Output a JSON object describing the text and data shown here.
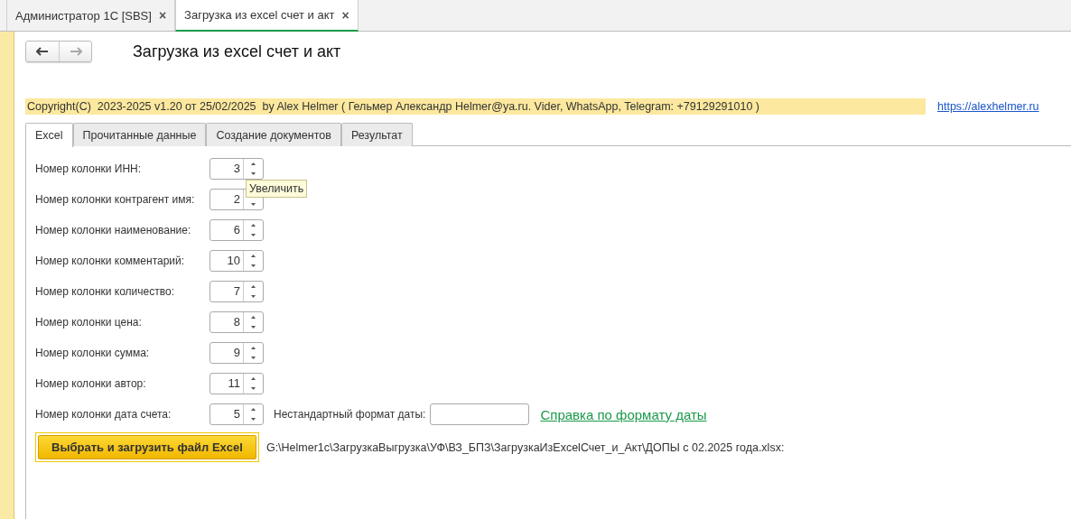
{
  "window_tabs": [
    {
      "label": "Администратор 1С [SBS]",
      "close": "×",
      "selected": false
    },
    {
      "label": "Загрузка из excel счет и акт",
      "close": "×",
      "selected": true
    }
  ],
  "nav": {
    "back_disabled": false,
    "forward_disabled": true
  },
  "title": "Загрузка из excel счет и акт",
  "copyright": "Copyright(C)  2023-2025 v1.20 от 25/02/2025  by Alex Helmer ( Гельмер Александр Helmer@ya.ru. Vider, WhatsApp, Telegram: +79129291010 )",
  "site_link": "https://alexhelmer.ru",
  "tabs": [
    {
      "label": "Excel",
      "selected": true
    },
    {
      "label": "Прочитанные данные",
      "selected": false
    },
    {
      "label": "Создание документов",
      "selected": false
    },
    {
      "label": "Результат",
      "selected": false
    }
  ],
  "fields": [
    {
      "label": "Номер колонки ИНН:",
      "value": "3"
    },
    {
      "label": "Номер колонки контрагент имя:",
      "value": "2"
    },
    {
      "label": "Номер колонки наименование:",
      "value": "6"
    },
    {
      "label": "Номер колонки комментарий:",
      "value": "10"
    },
    {
      "label": "Номер колонки количество:",
      "value": "7"
    },
    {
      "label": "Номер колонки цена:",
      "value": "8"
    },
    {
      "label": "Номер колонки сумма:",
      "value": "9"
    },
    {
      "label": "Номер колонки автор:",
      "value": "11"
    },
    {
      "label": "Номер колонки дата счета:",
      "value": "5"
    }
  ],
  "tooltip": "Увеличить",
  "date_format": {
    "label": "Нестандартный формат даты:",
    "link": "Справка по формату даты"
  },
  "load_button": "Выбрать и загрузить файл Excel",
  "file_path": "G:\\Helmer1c\\ЗагрузкаВыгрузка\\УФ\\ВЗ_БПЗ\\ЗагрузкаИзExcelСчет_и_Акт\\ДОПЫ с 02.2025 года.xlsx:"
}
